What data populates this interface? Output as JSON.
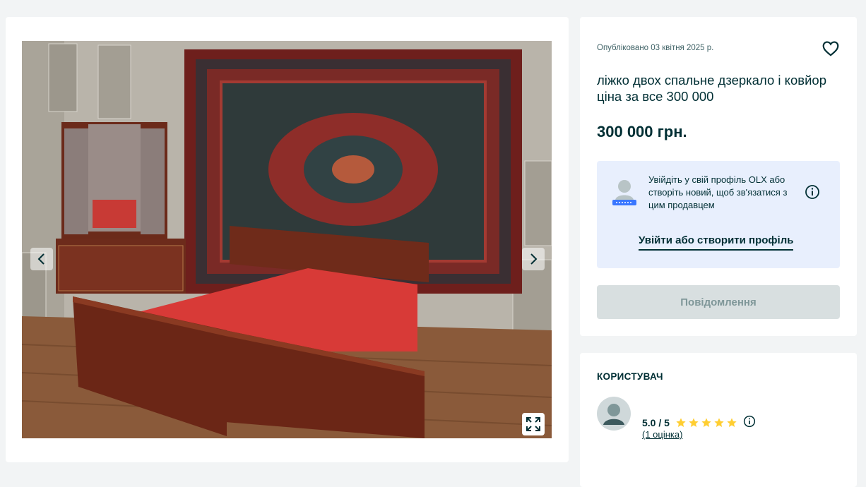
{
  "listing": {
    "published": "Опубліковано 03 квітня 2025 р.",
    "title": "ліжко двох спальне дзеркало і ковйор ціна за все 300 000",
    "price": "300 000 грн."
  },
  "login_prompt": {
    "text": "Увійдіть у свій профіль OLX або створіть новий, щоб зв'язатися з цим продавцем",
    "link_label": "Увійти або створити профіль"
  },
  "actions": {
    "message_label": "Повідомлення"
  },
  "user": {
    "heading": "КОРИСТУВАЧ",
    "rating": "5.0 / 5",
    "rating_count": "(1 оцінка)",
    "stars_filled": 5
  },
  "icons": {
    "favorite": "heart-icon",
    "info": "info-icon",
    "prev": "chevron-left-icon",
    "next": "chevron-right-icon",
    "fullscreen": "expand-icon",
    "star": "star-icon"
  },
  "colors": {
    "page_bg": "#f2f4f5",
    "text": "#002f34",
    "login_box_bg": "#e8effd",
    "disabled_button": "#d8dfe0",
    "star": "#ffce32"
  }
}
